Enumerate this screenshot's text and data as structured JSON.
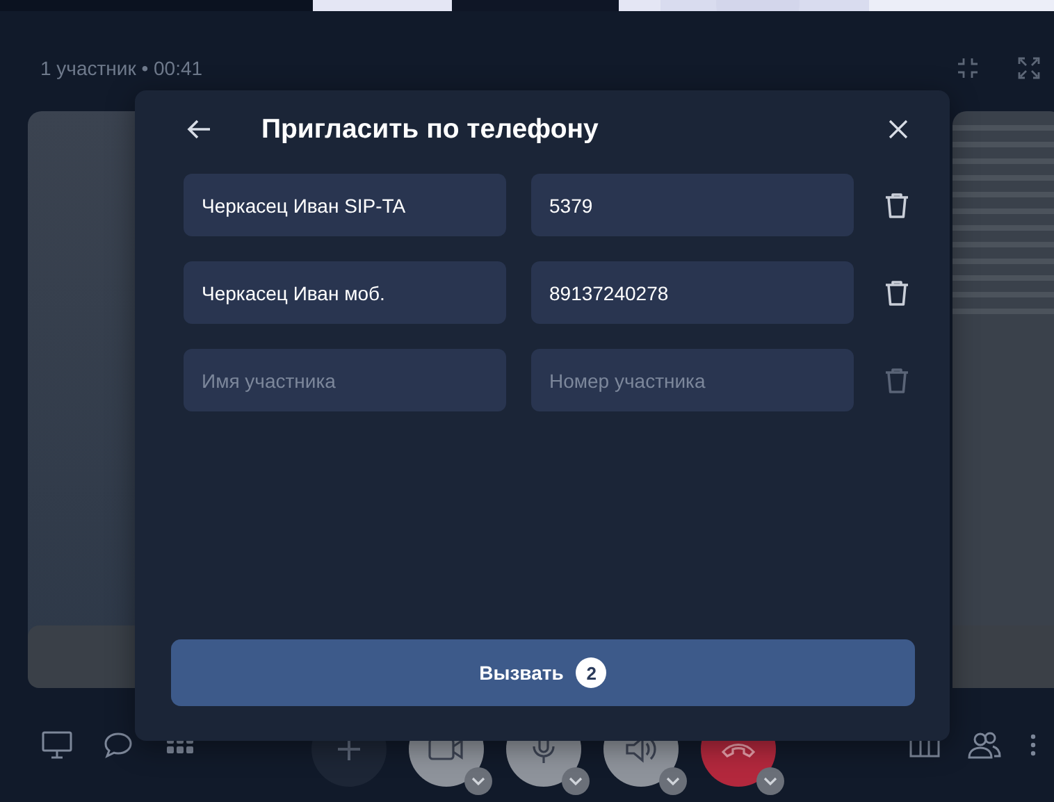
{
  "call_info": "1 участник • 00:41",
  "dialog": {
    "title": "Пригласить по телефону",
    "rows": [
      {
        "name": {
          "value": "Черкасец Иван SIP-TA"
        },
        "number": {
          "value": "5379"
        },
        "disabled": false
      },
      {
        "name": {
          "value": "Черкасец Иван моб."
        },
        "number": {
          "value": "89137240278"
        },
        "disabled": false
      },
      {
        "name": {
          "placeholder": "Имя участника"
        },
        "number": {
          "placeholder": "Номер участника"
        },
        "disabled": true
      }
    ],
    "call_button": {
      "label": "Вызвать",
      "badge": "2"
    }
  }
}
